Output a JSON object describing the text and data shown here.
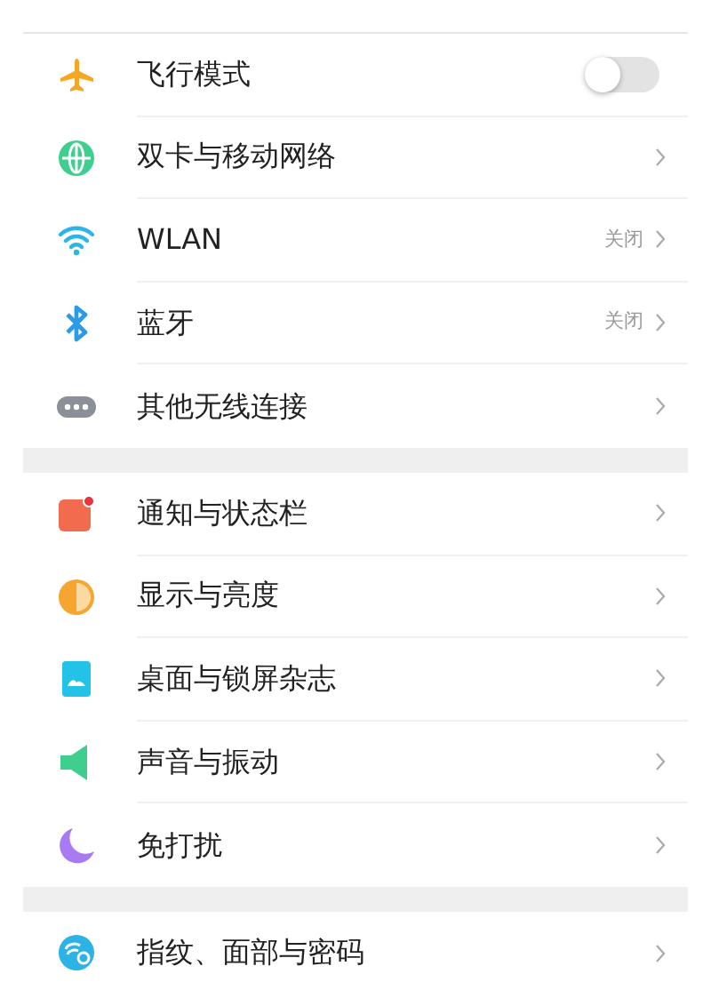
{
  "sections": [
    {
      "items": [
        {
          "label": "飞行模式",
          "kind": "toggle",
          "on": false
        },
        {
          "label": "双卡与移动网络",
          "kind": "link"
        },
        {
          "label": "WLAN",
          "kind": "link",
          "value": "关闭"
        },
        {
          "label": "蓝牙",
          "kind": "link",
          "value": "关闭"
        },
        {
          "label": "其他无线连接",
          "kind": "link"
        }
      ]
    },
    {
      "items": [
        {
          "label": "通知与状态栏",
          "kind": "link"
        },
        {
          "label": "显示与亮度",
          "kind": "link"
        },
        {
          "label": "桌面与锁屏杂志",
          "kind": "link"
        },
        {
          "label": "声音与振动",
          "kind": "link"
        },
        {
          "label": "免打扰",
          "kind": "link"
        }
      ]
    },
    {
      "items": [
        {
          "label": "指纹、面部与密码",
          "kind": "link"
        }
      ]
    }
  ]
}
